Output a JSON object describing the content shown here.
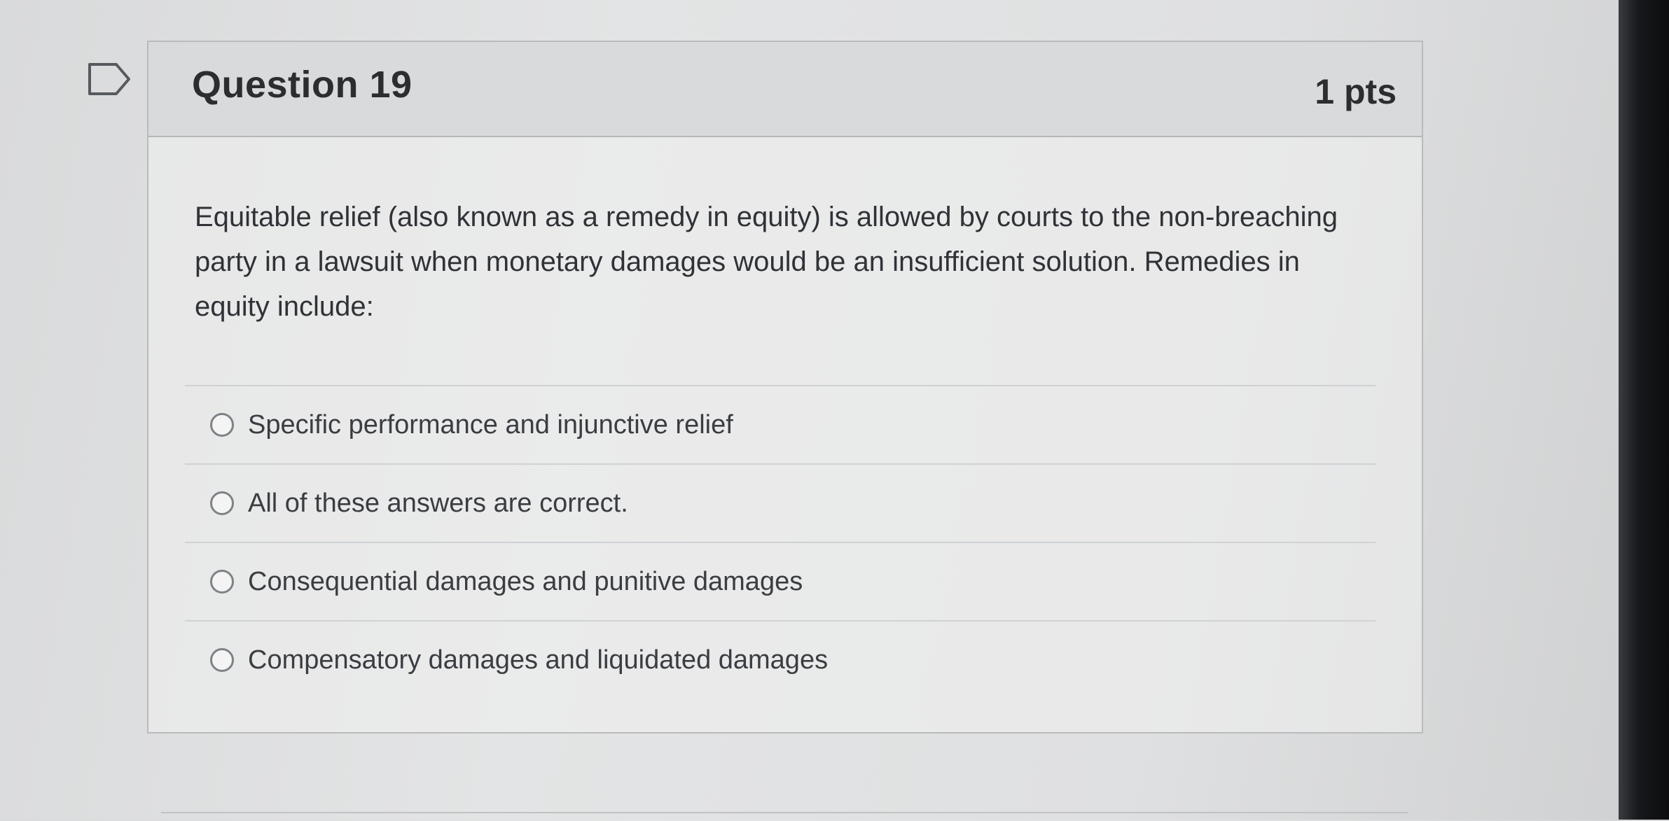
{
  "question": {
    "title": "Question 19",
    "points": "1 pts",
    "text": "Equitable relief (also known as a remedy in equity) is allowed by courts to the non-breaching party in a lawsuit when monetary damages would be an insufficient solution.  Remedies in equity include:"
  },
  "answers": [
    {
      "label": "Specific performance and injunctive relief",
      "selected": false
    },
    {
      "label": "All of these answers are correct.",
      "selected": false
    },
    {
      "label": "Consequential damages and punitive damages",
      "selected": false
    },
    {
      "label": "Compensatory damages and liquidated damages",
      "selected": false
    }
  ]
}
